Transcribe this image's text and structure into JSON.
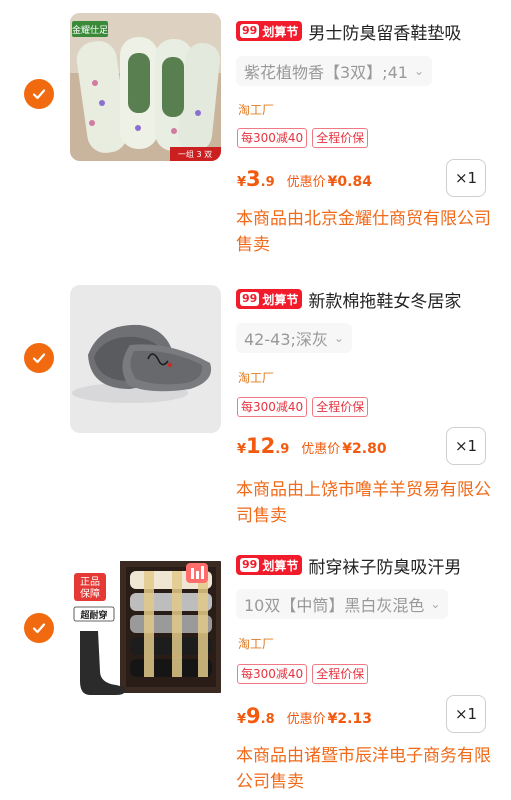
{
  "promo_tag": {
    "num": "99",
    "text": "划算节"
  },
  "items": [
    {
      "title": "男士防臭留香鞋垫吸",
      "sku": "紫花植物香【3双】;41",
      "shop_label": "淘工厂",
      "badges": [
        "每300减40",
        "全程价保"
      ],
      "price": {
        "yen": "¥",
        "int": "3",
        "dec": ".9",
        "discount_label": "优惠价",
        "discount_value": "¥0.84"
      },
      "qty": "×1",
      "seller": "本商品由北京金耀仕商贸有限公司售卖",
      "image": {
        "brand_text": "金耀仕足",
        "pack_text": "一组 3 双"
      }
    },
    {
      "title": "新款棉拖鞋女冬居家",
      "sku": "42-43;深灰",
      "shop_label": "淘工厂",
      "badges": [
        "每300减40",
        "全程价保"
      ],
      "price": {
        "yen": "¥",
        "int": "12",
        "dec": ".9",
        "discount_label": "优惠价",
        "discount_value": "¥2.80"
      },
      "qty": "×1",
      "seller": "本商品由上饶市噜羊羊贸易有限公司售卖",
      "image": {}
    },
    {
      "title": "耐穿袜子防臭吸汗男",
      "sku": "10双【中筒】黑白灰混色",
      "shop_label": "淘工厂",
      "badges": [
        "每300减40",
        "全程价保"
      ],
      "price": {
        "yen": "¥",
        "int": "9",
        "dec": ".8",
        "discount_label": "优惠价",
        "discount_value": "¥2.13"
      },
      "qty": "×1",
      "seller": "本商品由诸暨市辰洋电子商务有限公司售卖",
      "image": {
        "guarantee_1": "正品",
        "guarantee_2": "保障",
        "tag": "超耐穿"
      }
    }
  ],
  "colors": {
    "accent": "#f26a10",
    "promo_red": "#f21b2b",
    "price_orange": "#f25a0f",
    "badge_red": "#e5333f"
  }
}
